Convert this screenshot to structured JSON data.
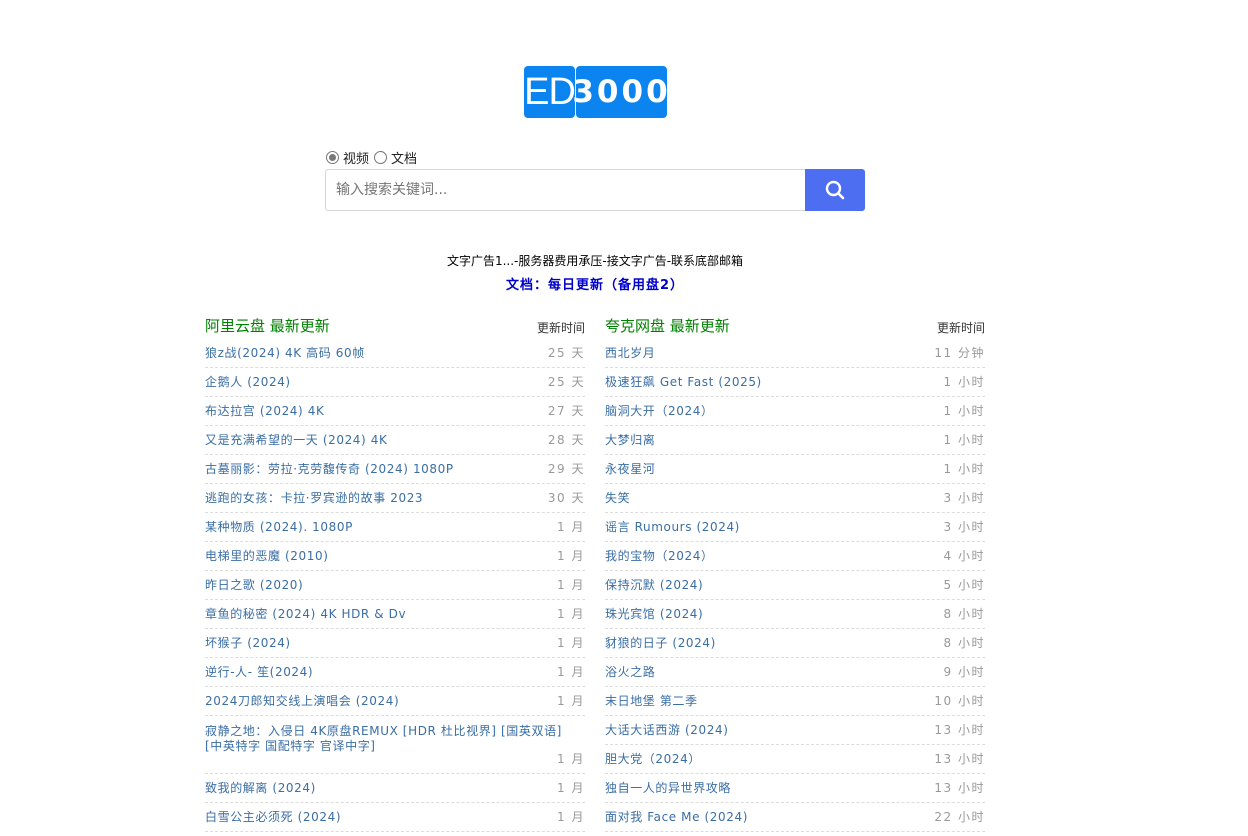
{
  "logo": {
    "part1": "ED",
    "part2": "3000"
  },
  "search": {
    "types": [
      {
        "label": "视频",
        "checked": true
      },
      {
        "label": "文档",
        "checked": false
      }
    ],
    "placeholder": "输入搜索关键词...",
    "button_icon": "search-icon"
  },
  "ad_text": "文字广告1...-服务器费用承压-接文字广告-联系底部邮箱",
  "doc_link": "文档：每日更新（备用盘2）",
  "columns": [
    {
      "title": "阿里云盘 最新更新",
      "time_header": "更新时间",
      "items": [
        {
          "title": "狼z战(2024) 4K 高码 60帧",
          "age": "25 天"
        },
        {
          "title": "企鹅人 (2024)",
          "age": "25 天"
        },
        {
          "title": "布达拉宫 (2024) 4K",
          "age": "27 天"
        },
        {
          "title": "又是充满希望的一天 (2024) 4K",
          "age": "28 天"
        },
        {
          "title": "古墓丽影：劳拉·克劳馥传奇 (2024) 1080P",
          "age": "29 天"
        },
        {
          "title": "逃跑的女孩：卡拉·罗宾逊的故事 2023",
          "age": "30 天"
        },
        {
          "title": "某种物质 (2024). 1080P",
          "age": "1 月"
        },
        {
          "title": "电梯里的恶魔 (2010)",
          "age": "1 月"
        },
        {
          "title": "昨日之歌 (2020)",
          "age": "1 月"
        },
        {
          "title": "章鱼的秘密 (2024) 4K HDR & Dv",
          "age": "1 月"
        },
        {
          "title": "坏猴子 (2024)",
          "age": "1 月"
        },
        {
          "title": "逆行-人- 笙(2024)",
          "age": "1 月"
        },
        {
          "title": "2024刀郎知交线上演唱会 (2024)",
          "age": "1 月"
        },
        {
          "title": "寂静之地：入侵日 4K原盘REMUX [HDR 杜比视界] [国英双语] [中英特字 国配特字 官译中字]",
          "age": "1 月",
          "tall": true
        },
        {
          "title": "致我的解离 (2024)",
          "age": "1 月"
        },
        {
          "title": "白雪公主必须死 (2024)",
          "age": "1 月"
        }
      ]
    },
    {
      "title": "夸克网盘 最新更新",
      "time_header": "更新时间",
      "items": [
        {
          "title": "西北岁月",
          "age": "11 分钟"
        },
        {
          "title": "极速狂飙 Get Fast (2025)",
          "age": "1 小时"
        },
        {
          "title": "脑洞大开（2024）",
          "age": "1 小时"
        },
        {
          "title": "大梦归离",
          "age": "1 小时"
        },
        {
          "title": "永夜星河",
          "age": "1 小时"
        },
        {
          "title": "失笑",
          "age": "3 小时"
        },
        {
          "title": "谣言 Rumours (2024)",
          "age": "3 小时"
        },
        {
          "title": "我的宝物（2024）",
          "age": "4 小时"
        },
        {
          "title": "保持沉默 (2024)",
          "age": "5 小时"
        },
        {
          "title": "珠光宾馆 (2024)",
          "age": "8 小时"
        },
        {
          "title": "豺狼的日子 (2024)",
          "age": "8 小时"
        },
        {
          "title": "浴火之路",
          "age": "9 小时"
        },
        {
          "title": "末日地堡 第二季",
          "age": "10 小时"
        },
        {
          "title": "大话大话西游 (2024)",
          "age": "13 小时"
        },
        {
          "title": "胆大党（2024）",
          "age": "13 小时"
        },
        {
          "title": "独自一人的异世界攻略",
          "age": "13 小时"
        },
        {
          "title": "面对我 Face Me (2024)",
          "age": "22 小时"
        }
      ]
    }
  ]
}
